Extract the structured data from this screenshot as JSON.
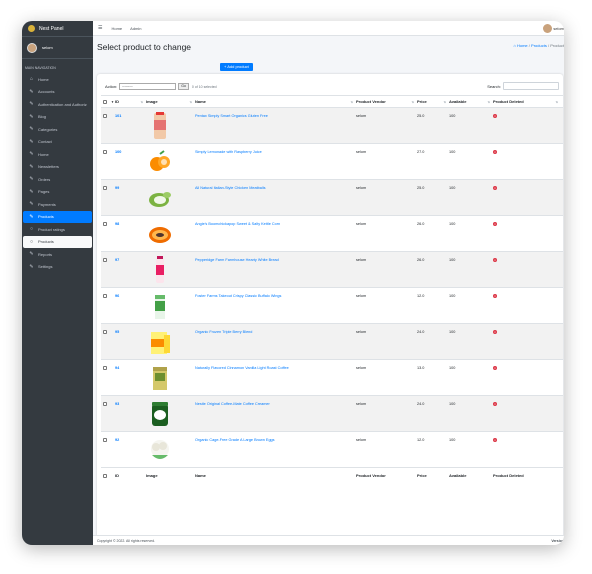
{
  "brand": {
    "title": "Nest Panel"
  },
  "user": {
    "name": "selom"
  },
  "sidebar": {
    "header": "MAIN NAVIGATION",
    "items": [
      {
        "label": "Home",
        "icon": "home-icon"
      },
      {
        "label": "Accounts",
        "icon": "edit-icon"
      },
      {
        "label": "Authentication and Authoriz",
        "icon": "edit-icon"
      },
      {
        "label": "Blog",
        "icon": "edit-icon"
      },
      {
        "label": "Categories",
        "icon": "edit-icon"
      },
      {
        "label": "Contact",
        "icon": "edit-icon"
      },
      {
        "label": "Home",
        "icon": "edit-icon"
      },
      {
        "label": "Newsletters",
        "icon": "edit-icon"
      },
      {
        "label": "Orders",
        "icon": "edit-icon"
      },
      {
        "label": "Pages",
        "icon": "edit-icon"
      },
      {
        "label": "Payments",
        "icon": "edit-icon"
      },
      {
        "label": "Products",
        "icon": "edit-icon"
      },
      {
        "label": "Product ratings",
        "icon": "circle-icon"
      },
      {
        "label": "Products",
        "icon": "circle-icon"
      },
      {
        "label": "Reports",
        "icon": "edit-icon"
      },
      {
        "label": "Settings",
        "icon": "edit-icon"
      }
    ]
  },
  "topbar": {
    "links": [
      "Home",
      "Admin"
    ],
    "user": "selom"
  },
  "page": {
    "title": "Select product to change",
    "breadcrumb": {
      "home": "Home",
      "sep": "/",
      "section": "Products",
      "current": "Product"
    },
    "add_button": "+ Add product",
    "action_label": "Action:",
    "action_select": "---------",
    "go_button": "Go",
    "selected_count": "0 of 10 selected",
    "search_label": "Search:",
    "pagination": {
      "pages": [
        "1",
        "2"
      ],
      "current": "2",
      "count_text": "20 products",
      "show_all": "Show all"
    }
  },
  "table": {
    "columns": [
      "ID",
      "Image",
      "Name",
      "Product Vendor",
      "Price",
      "Available",
      "Product Deleted"
    ],
    "rows": [
      {
        "id": "101",
        "name": "Pentax Simply Smart Organics Gluten Free",
        "vendor": "selom",
        "price": "25.0",
        "available": "100",
        "image": "peach-jar-thumbnail"
      },
      {
        "id": "100",
        "name": "Simply Lemonade with Raspberry Juice",
        "vendor": "selom",
        "price": "27.0",
        "available": "100",
        "image": "orange-slices-thumbnail"
      },
      {
        "id": "99",
        "name": "All Natural Italian-Style Chicken Meatballs",
        "vendor": "selom",
        "price": "25.0",
        "available": "100",
        "image": "coconut-thumbnail"
      },
      {
        "id": "98",
        "name": "Angie's Boomchickapop Sweet & Salty Kettle Corn",
        "vendor": "selom",
        "price": "26.0",
        "available": "100",
        "image": "papaya-thumbnail"
      },
      {
        "id": "97",
        "name": "Pepperidge Farm Farmhouse Hearty White Bread",
        "vendor": "selom",
        "price": "26.0",
        "available": "100",
        "image": "drink-bottle-thumbnail"
      },
      {
        "id": "96",
        "name": "Foster Farms Takeout Crispy Classic Buffalo Wings",
        "vendor": "selom",
        "price": "12.0",
        "available": "100",
        "image": "green-tube-thumbnail"
      },
      {
        "id": "95",
        "name": "Organic Frozen Triple Berry Blend",
        "vendor": "selom",
        "price": "24.0",
        "available": "100",
        "image": "yellow-box-thumbnail"
      },
      {
        "id": "94",
        "name": "Naturally Flavored Cinnamon Vanilla Light Roast Coffee",
        "vendor": "selom",
        "price": "13.0",
        "available": "100",
        "image": "coffee-box-thumbnail"
      },
      {
        "id": "93",
        "name": "Nestle Original Coffee-Mate Coffee Creamer",
        "vendor": "selom",
        "price": "24.0",
        "available": "100",
        "image": "green-tin-thumbnail"
      },
      {
        "id": "92",
        "name": "Organic Cage-Free Grade A Large Brown Eggs",
        "vendor": "selom",
        "price": "12.0",
        "available": "100",
        "image": "cauliflower-thumbnail"
      }
    ]
  },
  "footer": {
    "copyright": "Copyright © 2022. All rights reserved.",
    "version": "Version"
  },
  "colors": {
    "sidebar": "#343a40",
    "accent": "#007bff",
    "danger": "#dc3545"
  }
}
